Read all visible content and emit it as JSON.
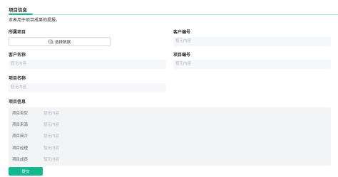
{
  "tab": {
    "title": "项目信息"
  },
  "description": "本表用于项目成果的提报。",
  "project_select": {
    "label": "所属项目",
    "button_label": "选择数据",
    "icon": "select-data-icon"
  },
  "customer_code": {
    "label": "客户编号",
    "placeholder": "暂无内容"
  },
  "customer_name": {
    "label": "客户名称",
    "placeholder": "暂无内容"
  },
  "project_code": {
    "label": "项目编号",
    "placeholder": "暂无内容"
  },
  "project_name": {
    "label": "项目名称",
    "placeholder": "暂无内容"
  },
  "project_info": {
    "label": "项目信息",
    "rows": [
      {
        "key": "项目类型",
        "value": "暂无内容"
      },
      {
        "key": "项目来源",
        "value": "暂无内容"
      },
      {
        "key": "项目简介",
        "value": "暂无内容"
      },
      {
        "key": "项目经理",
        "value": "暂无内容"
      },
      {
        "key": "项目成员",
        "value": "暂无内容"
      }
    ]
  },
  "submit": {
    "label": "提交"
  },
  "colors": {
    "accent": "#14b890",
    "field_bg": "#f5f7fa",
    "placeholder": "#b4b8c0"
  }
}
